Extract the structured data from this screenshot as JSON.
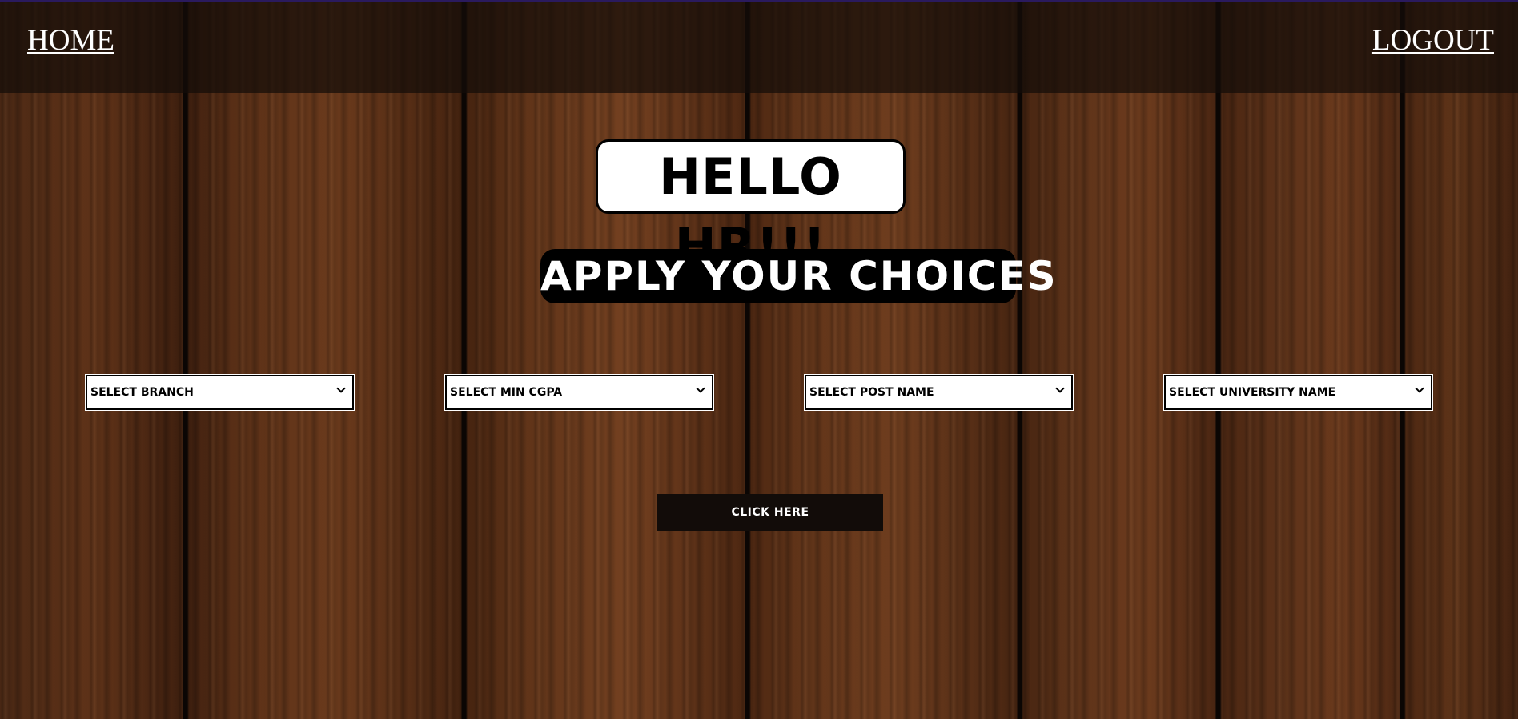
{
  "nav": {
    "home_label": "HOME",
    "logout_label": "LOGOUT"
  },
  "main": {
    "greeting": "HELLO HR!!!",
    "subtitle": "APPLY YOUR CHOICES",
    "filters": [
      {
        "selected": "SELECT BRANCH"
      },
      {
        "selected": "SELECT MIN CGPA"
      },
      {
        "selected": "SELECT POST NAME"
      },
      {
        "selected": "SELECT UNIVERSITY NAME"
      }
    ],
    "submit_label": "CLICK HERE"
  },
  "colors": {
    "navbar_bg": "#140c08",
    "button_bg": "#120c09",
    "wood": "#5a3118"
  }
}
